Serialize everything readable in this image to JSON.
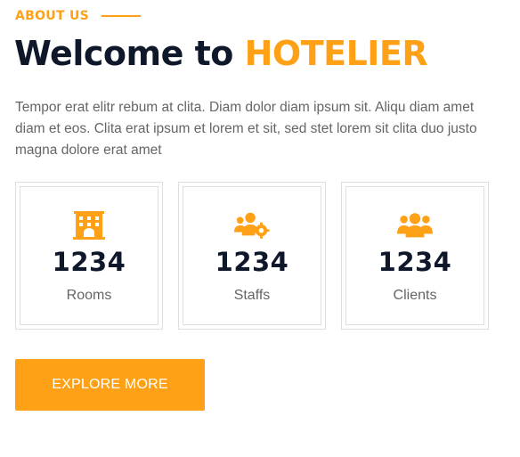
{
  "about": {
    "eyebrow": "ABOUT US",
    "title_prefix": "Welcome to ",
    "title_brand": "HOTELIER",
    "description": "Tempor erat elitr rebum at clita. Diam dolor diam ipsum sit. Aliqu diam amet diam et eos. Clita erat ipsum et lorem et sit, sed stet lorem sit clita duo justo magna dolore erat amet"
  },
  "stats": [
    {
      "icon": "hotel-icon",
      "number": "1234",
      "label": "Rooms"
    },
    {
      "icon": "users-cog-icon",
      "number": "1234",
      "label": "Staffs"
    },
    {
      "icon": "users-icon",
      "number": "1234",
      "label": "Clients"
    }
  ],
  "cta": {
    "label": "Explore More"
  },
  "colors": {
    "accent": "#FEA116",
    "dark": "#0F172B",
    "body_text": "#666565",
    "border": "#dedede"
  }
}
